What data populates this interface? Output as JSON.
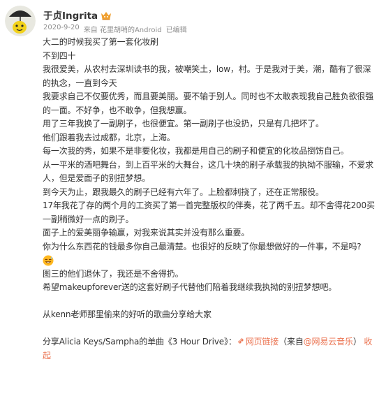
{
  "user": {
    "name": "于贞Ingrita",
    "avatar_icon": "mascot-with-umbrella-icon",
    "badge_icon": "vip-crown-icon",
    "badge_color": "#f0a030"
  },
  "meta": {
    "date": "2020-9-20",
    "source": "来自 花里胡哨的Android",
    "edited": "已编辑"
  },
  "post": {
    "lines": [
      "大二的时候我买了第一套化妆刷",
      "不到四十",
      "我很爱美，从农村去深圳读书的我，被嘲笑土，low，村。于是我对于美，潮，酷有了很深的执念，一直到今天",
      "我要求自己不仅要优秀，而且要美丽。要不输于别人。同时也不太敢表现我自己胜负欲很强的一面。不好争，也不敢争，但我想赢。",
      "用了三年我换了一副刷子，也很便宜。第一副刷子也没扔，只是有几把坏了。",
      "他们跟着我去过成都，北京，上海。",
      "每一次我的秀，如果不是非要化妆，我都是用自己的刷子和便宜的化妆品捯饬自己。",
      "从一平米的酒吧舞台，到上百平米的大舞台，这几十块的刷子承载我的执拗不服输，不爱求人，但是爱面子的别扭梦想。",
      "到今天为止，跟我最久的刷子已经有六年了。上脸都刺挠了，还在正常服役。",
      "17年我花了存的两个月的工资买了第一首完整版权的伴奏，花了两千五。却不舍得花200买一副稍微好一点的刷子。",
      "面子上的爱美丽争输赢，对我来说其实并没有那么重要。",
      "你为什么东西花的钱最多你自己最清楚。也很好的反映了你最想做好的一件事，不是吗?"
    ],
    "emoji_icon": "sweat-smile-emoji-icon",
    "lines_after": [
      "图三的他们退休了，我还是不舍得扔。",
      "希望makeupforever送的这套好刷子代替他们陪着我继续我执拗的别扭梦想吧。"
    ],
    "music_line": "从kenn老师那里偷来的好听的歌曲分享给大家",
    "share": {
      "prefix": "分享Alicia Keys/Sampha的单曲《3 Hour Drive》：",
      "link_icon": "link-icon",
      "link_text": "网页链接",
      "source_open": "（来自",
      "source_link": "@网易云音乐",
      "source_close": "）",
      "collapse": "收起"
    },
    "link_color": "#eb7350"
  }
}
